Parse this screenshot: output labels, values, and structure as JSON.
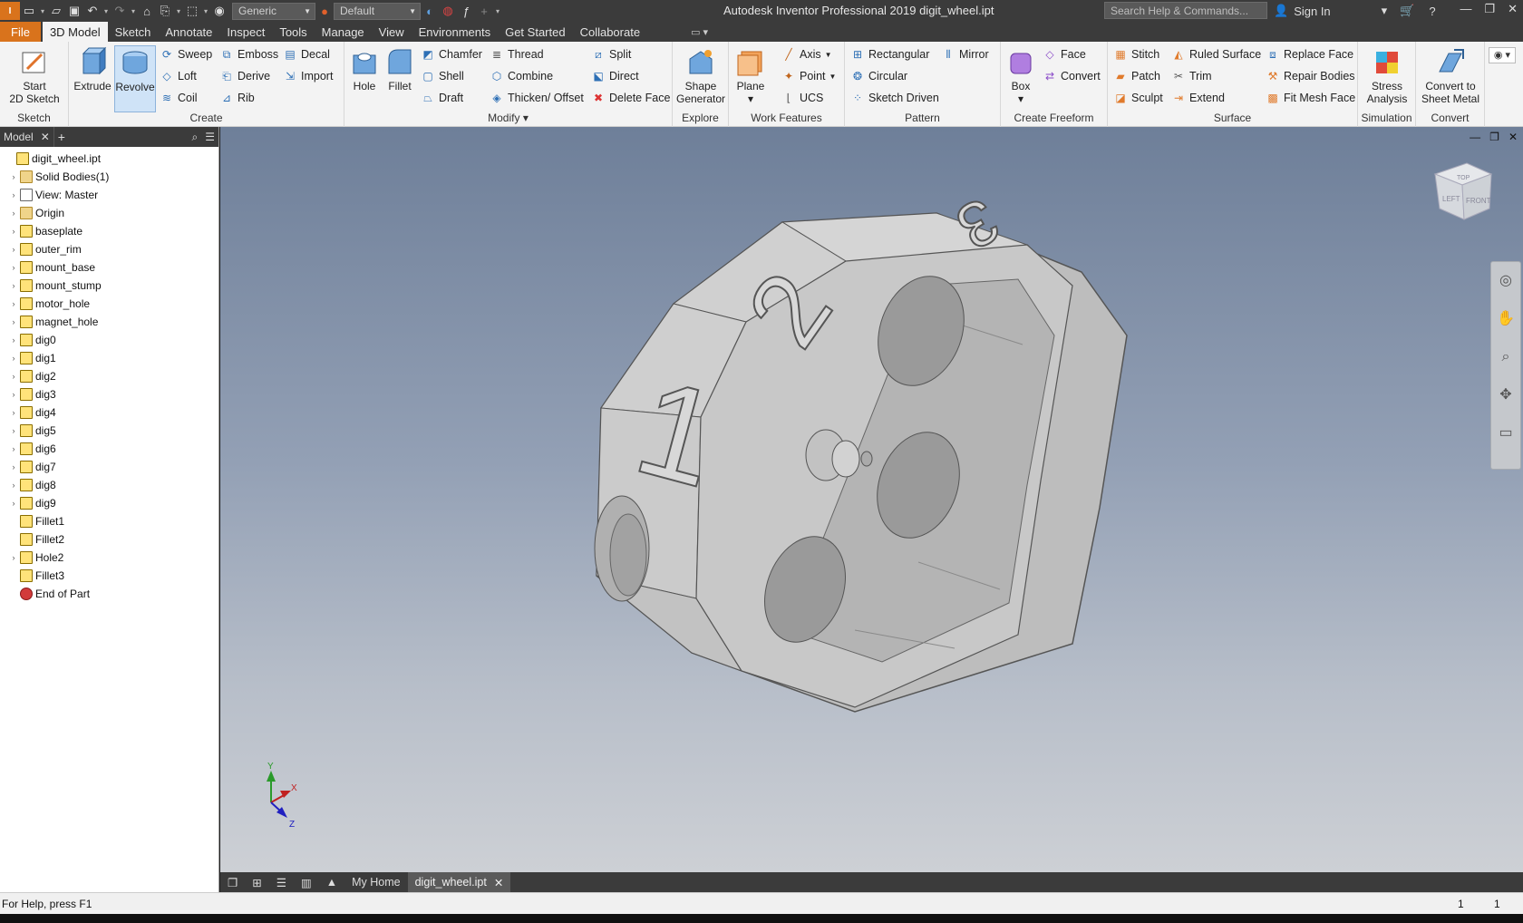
{
  "titlebar": {
    "app_title": "Autodesk Inventor Professional 2019   digit_wheel.ipt",
    "material_combo": "Generic",
    "appearance_combo": "Default",
    "search_placeholder": "Search Help & Commands...",
    "sign_in": "Sign In"
  },
  "menu_tabs": [
    "File",
    "3D Model",
    "Sketch",
    "Annotate",
    "Inspect",
    "Tools",
    "Manage",
    "View",
    "Environments",
    "Get Started",
    "Collaborate"
  ],
  "ribbon": {
    "sketch": {
      "start": "Start",
      "start2": "2D Sketch",
      "title": "Sketch"
    },
    "create": {
      "extrude": "Extrude",
      "revolve": "Revolve",
      "sweep": "Sweep",
      "loft": "Loft",
      "coil": "Coil",
      "emboss": "Emboss",
      "derive": "Derive",
      "rib": "Rib",
      "decal": "Decal",
      "import": "Import",
      "title": "Create"
    },
    "modify": {
      "hole": "Hole",
      "fillet": "Fillet",
      "chamfer": "Chamfer",
      "shell": "Shell",
      "draft": "Draft",
      "thread": "Thread",
      "combine": "Combine",
      "thicken": "Thicken/ Offset",
      "split": "Split",
      "direct": "Direct",
      "delete_face": "Delete Face",
      "title": "Modify"
    },
    "explore": {
      "shape": "Shape",
      "generator": "Generator",
      "title": "Explore"
    },
    "work": {
      "plane": "Plane",
      "axis": "Axis",
      "point": "Point",
      "ucs": "UCS",
      "title": "Work Features"
    },
    "pattern": {
      "rectangular": "Rectangular",
      "circular": "Circular",
      "sketch_driven": "Sketch Driven",
      "mirror": "Mirror",
      "title": "Pattern"
    },
    "freeform": {
      "box": "Box",
      "face": "Face",
      "convert": "Convert",
      "title": "Create Freeform"
    },
    "surface": {
      "stitch": "Stitch",
      "patch": "Patch",
      "sculpt": "Sculpt",
      "ruled": "Ruled Surface",
      "trim": "Trim",
      "extend": "Extend",
      "replace": "Replace Face",
      "repair": "Repair Bodies",
      "fitmesh": "Fit Mesh Face",
      "title": "Surface"
    },
    "simulation": {
      "stress": "Stress",
      "analysis": "Analysis",
      "title": "Simulation"
    },
    "convert": {
      "c1": "Convert to",
      "c2": "Sheet Metal",
      "title": "Convert"
    }
  },
  "browser": {
    "tab_label": "Model",
    "items": [
      {
        "label": "digit_wheel.ipt",
        "type": "part",
        "exp": false,
        "indent": 0
      },
      {
        "label": "Solid Bodies(1)",
        "type": "folder",
        "exp": true,
        "indent": 1
      },
      {
        "label": "View: Master",
        "type": "view",
        "exp": true,
        "indent": 1
      },
      {
        "label": "Origin",
        "type": "folder",
        "exp": true,
        "indent": 1
      },
      {
        "label": "baseplate",
        "type": "part",
        "exp": true,
        "indent": 1
      },
      {
        "label": "outer_rim",
        "type": "part",
        "exp": true,
        "indent": 1
      },
      {
        "label": "mount_base",
        "type": "part",
        "exp": true,
        "indent": 1
      },
      {
        "label": "mount_stump",
        "type": "part",
        "exp": true,
        "indent": 1
      },
      {
        "label": "motor_hole",
        "type": "part",
        "exp": true,
        "indent": 1
      },
      {
        "label": "magnet_hole",
        "type": "hole",
        "exp": true,
        "indent": 1
      },
      {
        "label": "dig0",
        "type": "part",
        "exp": true,
        "indent": 1
      },
      {
        "label": "dig1",
        "type": "part",
        "exp": true,
        "indent": 1
      },
      {
        "label": "dig2",
        "type": "part",
        "exp": true,
        "indent": 1
      },
      {
        "label": "dig3",
        "type": "part",
        "exp": true,
        "indent": 1
      },
      {
        "label": "dig4",
        "type": "part",
        "exp": true,
        "indent": 1
      },
      {
        "label": "dig5",
        "type": "part",
        "exp": true,
        "indent": 1
      },
      {
        "label": "dig6",
        "type": "part",
        "exp": true,
        "indent": 1
      },
      {
        "label": "dig7",
        "type": "part",
        "exp": true,
        "indent": 1
      },
      {
        "label": "dig8",
        "type": "part",
        "exp": true,
        "indent": 1
      },
      {
        "label": "dig9",
        "type": "part",
        "exp": true,
        "indent": 1
      },
      {
        "label": "Fillet1",
        "type": "fillet",
        "exp": false,
        "indent": 1
      },
      {
        "label": "Fillet2",
        "type": "fillet",
        "exp": false,
        "indent": 1
      },
      {
        "label": "Hole2",
        "type": "hole",
        "exp": true,
        "indent": 1
      },
      {
        "label": "Fillet3",
        "type": "fillet",
        "exp": false,
        "indent": 1
      },
      {
        "label": "End of Part",
        "type": "end",
        "exp": false,
        "indent": 1
      }
    ]
  },
  "viewcube": {
    "top": "TOP",
    "left": "LEFT",
    "front": "FRONT"
  },
  "model_digits": [
    "1",
    "2",
    "3"
  ],
  "triad": {
    "x": "X",
    "y": "Y",
    "z": "Z"
  },
  "doc_tabs": {
    "home": "My Home",
    "file": "digit_wheel.ipt"
  },
  "status": {
    "help": "For Help, press F1",
    "n1": "1",
    "n2": "1"
  }
}
